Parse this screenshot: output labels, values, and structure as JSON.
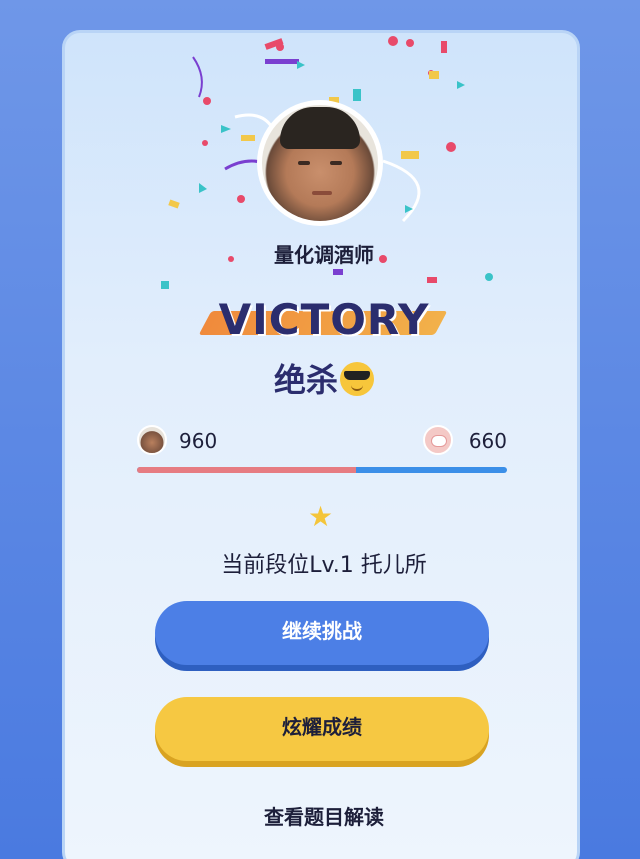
{
  "player": {
    "name": "量化调酒师"
  },
  "result": {
    "banner": "VICTORY",
    "text": "绝杀",
    "emoji_icon": "smiling-face-with-sunglasses-icon"
  },
  "scores": {
    "left": "960",
    "right": "660",
    "left_fraction": 0.593,
    "left_color": "#e67c82",
    "right_color": "#3b8fe8"
  },
  "rank": {
    "icon": "star-icon",
    "text": "当前段位Lv.1 托儿所"
  },
  "buttons": {
    "continue": "继续挑战",
    "share": "炫耀成绩",
    "view_answers": "查看题目解读"
  },
  "colors": {
    "accent_blue": "#4c7fe6",
    "accent_yellow": "#f6c842",
    "text_dark": "#1d1f3a"
  }
}
